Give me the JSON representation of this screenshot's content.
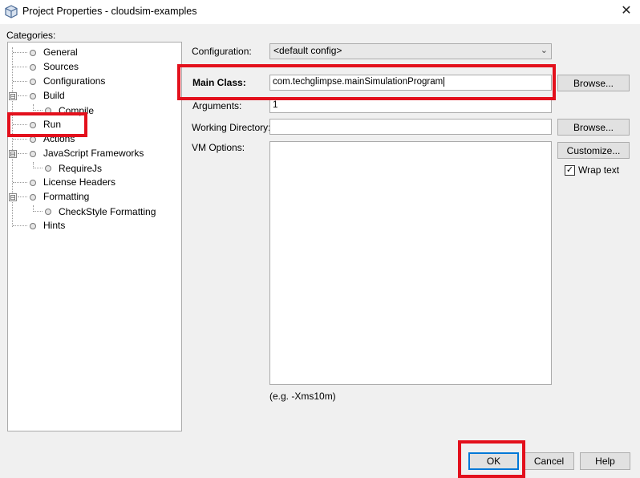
{
  "window": {
    "title": "Project Properties - cloudsim-examples",
    "close_glyph": "✕"
  },
  "categories": {
    "label": "Categories:",
    "items": [
      {
        "label": "General"
      },
      {
        "label": "Sources"
      },
      {
        "label": "Configurations"
      },
      {
        "label": "Build",
        "expander": "⊟"
      },
      {
        "label": "Compile"
      },
      {
        "label": "Run"
      },
      {
        "label": "Actions"
      },
      {
        "label": "JavaScript Frameworks",
        "expander": "⊟"
      },
      {
        "label": "RequireJs"
      },
      {
        "label": "License Headers"
      },
      {
        "label": "Formatting",
        "expander": "⊟"
      },
      {
        "label": "CheckStyle Formatting"
      },
      {
        "label": "Hints"
      }
    ]
  },
  "form": {
    "configuration_label": "Configuration:",
    "configuration_value": "<default config>",
    "main_class_label": "Main Class:",
    "main_class_value": "com.techglimpse.mainSimulationProgram",
    "arguments_label": "Arguments:",
    "arguments_value": "1",
    "working_dir_label": "Working Directory:",
    "working_dir_value": "",
    "vm_options_label": "VM Options:",
    "vm_options_value": "",
    "vm_hint": "(e.g. -Xms10m)",
    "browse_label": "Browse...",
    "customize_label": "Customize...",
    "wrap_text_label": "Wrap text",
    "wrap_text_checked": true
  },
  "footer": {
    "ok_label": "OK",
    "cancel_label": "Cancel",
    "help_label": "Help"
  },
  "colors": {
    "highlight_box": "#e3101c",
    "default_button_border": "#0078d7"
  }
}
